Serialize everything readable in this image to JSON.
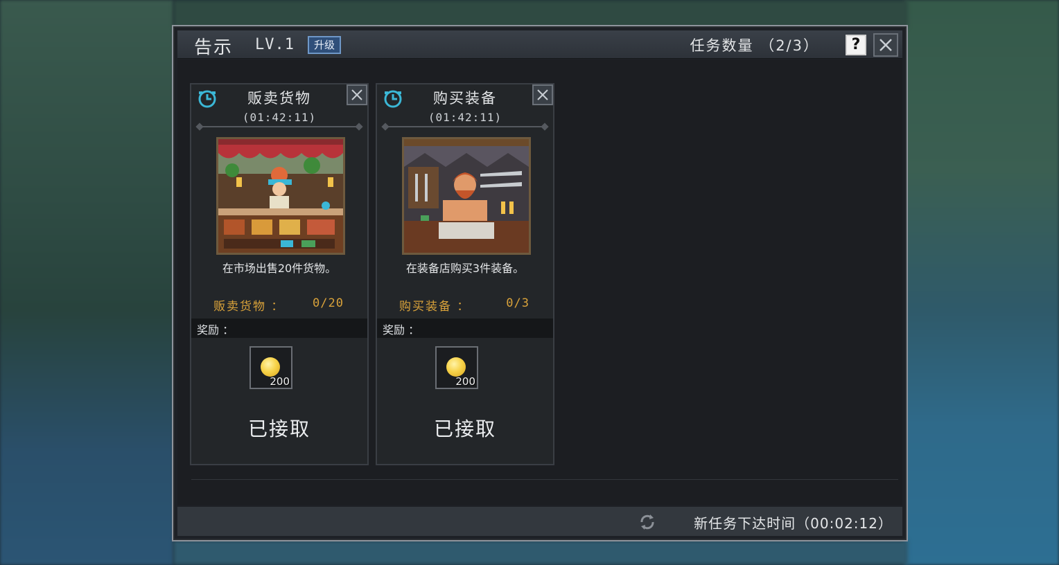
{
  "window": {
    "title": "告示",
    "level": "LV.1",
    "upgrade_label": "升级",
    "quest_count": "任务数量 （2/3）",
    "help_label": "?"
  },
  "cards": [
    {
      "title": "贩卖货物",
      "timer": "(01:42:11)",
      "description": "在市场出售20件货物。",
      "progress_label": "贩卖货物 ：",
      "progress_value": "0/20",
      "reward_label": "奖励 ：",
      "reward_qty": "200",
      "status": "已接取"
    },
    {
      "title": "购买装备",
      "timer": "(01:42:11)",
      "description": "在装备店购买3件装备。",
      "progress_label": "购买装备 ：",
      "progress_value": "0/3",
      "reward_label": "奖励 ：",
      "reward_qty": "200",
      "status": "已接取"
    }
  ],
  "footer": {
    "next_quest_text": "新任务下达时间（00:02:12）"
  },
  "colors": {
    "progress": "#d9a23a",
    "upgrade_bg": "#2f4f7a",
    "clock_icon": "#3bb7d6"
  }
}
